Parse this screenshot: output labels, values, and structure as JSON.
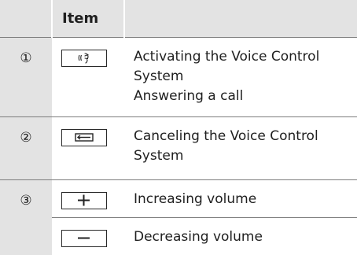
{
  "table": {
    "header": {
      "col1": "",
      "col2": "Item",
      "col3": ""
    },
    "rows": [
      {
        "number": "①",
        "icon": "voice-control-key-icon",
        "lines": [
          "Activating the Voice Control",
          "System",
          "Answering a call"
        ]
      },
      {
        "number": "②",
        "icon": "back-hangup-key-icon",
        "lines": [
          "Canceling the Voice Control",
          "System"
        ]
      },
      {
        "number": "③",
        "icon": "plus-key-icon",
        "lines": [
          "Increasing volume"
        ]
      },
      {
        "number": "",
        "icon": "minus-key-icon",
        "lines": [
          "Decreasing volume"
        ]
      }
    ]
  }
}
